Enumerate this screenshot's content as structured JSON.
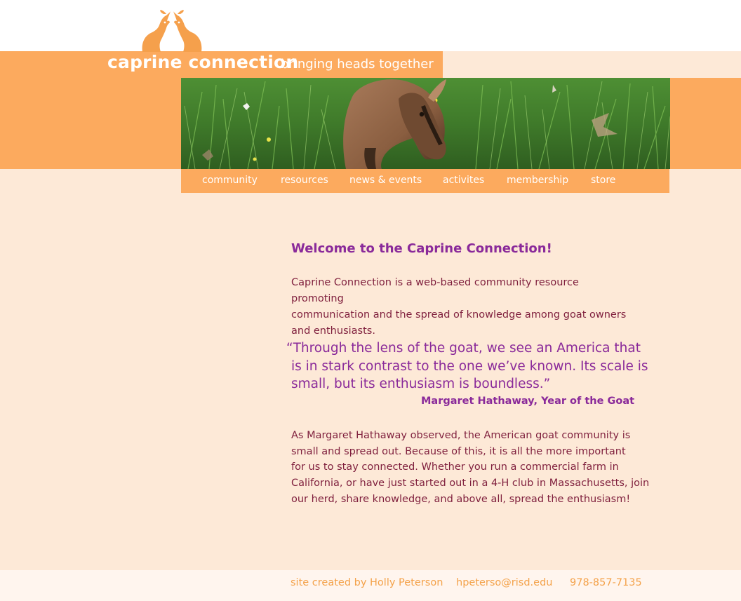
{
  "header": {
    "title": "caprine connection",
    "tagline": "bringing heads together"
  },
  "nav": {
    "items": [
      {
        "label": "community"
      },
      {
        "label": "resources"
      },
      {
        "label": "news & events"
      },
      {
        "label": "activites"
      },
      {
        "label": "membership"
      },
      {
        "label": "store"
      }
    ]
  },
  "main": {
    "heading": "Welcome to the Caprine Connection!",
    "intro_lines": [
      "Caprine Connection is a web-based community resource promoting",
      "communication and the spread of knowledge among goat owners",
      "and enthusiasts."
    ],
    "quote_lines": [
      "“Through the lens of the goat, we see an America that",
      "is in stark contrast to the one we’ve known. Its scale is",
      "small, but its enthusiasm is boundless.”"
    ],
    "attribution": "Margaret Hathaway, Year of the Goat",
    "body_lines": [
      "As Margaret Hathaway observed, the American goat community is",
      "small and spread out. Because of this, it is all the more important",
      "for us to stay connected. Whether you run a commercial farm in",
      "California, or have just started out in a 4-H club in Massachusetts, join",
      "our herd, share knowledge, and above all, spread the enthusiasm!"
    ]
  },
  "footer": {
    "credit": "site created by Holly Peterson",
    "email": "hpeterso@risd.edu",
    "phone": "978-857-7135"
  },
  "colors": {
    "accent_orange": "#fcaa5e",
    "background_cream": "#fde9d7",
    "heading_purple": "#8a2a9a",
    "text_maroon": "#7f1f3d"
  },
  "icons": {
    "logo": "two-goats-logo-icon",
    "hero": "goat-kid-in-grass-photo"
  }
}
